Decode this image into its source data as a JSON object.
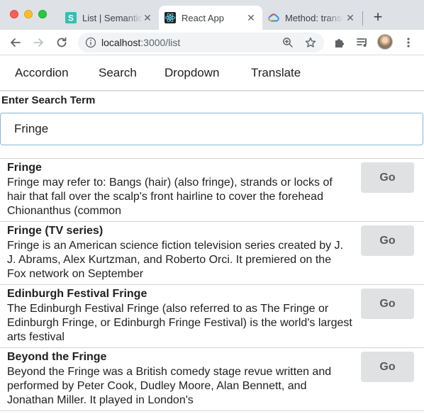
{
  "browser": {
    "tabs": [
      {
        "title": "List | Semantic UI",
        "active": false
      },
      {
        "title": "React App",
        "active": true
      },
      {
        "title": "Method: translations",
        "active": false
      }
    ],
    "url_host": "localhost",
    "url_path": ":3000/list",
    "new_tab_symbol": "+",
    "close_symbol": "✕"
  },
  "nav": {
    "items": [
      "Accordion",
      "Search",
      "Dropdown",
      "Translate"
    ]
  },
  "search": {
    "label": "Enter Search Term",
    "value": "Fringe"
  },
  "results": [
    {
      "title": "Fringe",
      "snippet": "Fringe may refer to: Bangs (hair) (also fringe), strands or locks of hair that fall over the scalp's front hairline to cover the forehead Chionanthus (common",
      "button": "Go"
    },
    {
      "title": "Fringe (TV series)",
      "snippet": "Fringe is an American science fiction television series created by J. J. Abrams, Alex Kurtzman, and Roberto Orci. It premiered on the Fox network on September",
      "button": "Go"
    },
    {
      "title": "Edinburgh Festival Fringe",
      "snippet": "The Edinburgh Festival Fringe (also referred to as The Fringe or Edinburgh Fringe, or Edinburgh Fringe Festival) is the world's largest arts festival",
      "button": "Go"
    },
    {
      "title": "Beyond the Fringe",
      "snippet": "Beyond the Fringe was a British comedy stage revue written and performed by Peter Cook, Dudley Moore, Alan Bennett, and Jonathan Miller. It played in London's",
      "button": "Go"
    }
  ],
  "colors": {
    "button_bg": "#e0e1e2",
    "input_focus_border": "#85b7d9",
    "tabstrip_bg": "#dee1e6"
  }
}
